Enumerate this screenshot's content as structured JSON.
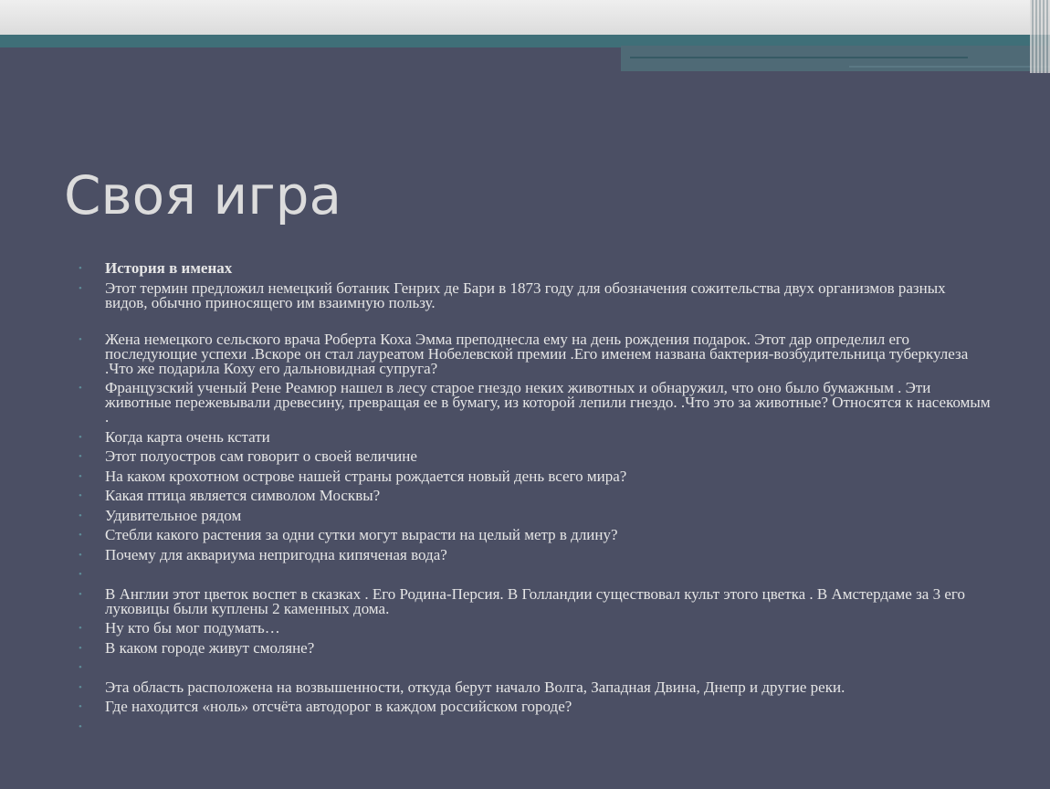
{
  "slide": {
    "title": "Своя игра",
    "bullet_glyph": "•",
    "items": [
      {
        "text": "История в именах",
        "bold": true
      },
      {
        "text": "Этот термин предложил немецкий ботаник  Генрих де Бари в 1873 году для обозначения сожительства двух организмов разных видов, обычно приносящего им взаимную пользу."
      },
      {
        "text": "Жена немецкого сельского врача Роберта Коха Эмма преподнесла ему на день рождения подарок. Этот дар определил его последующие успехи .Вскоре он стал лауреатом Нобелевской премии .Его именем названа бактерия-возбудительница туберкулеза .Что же подарила Коху его дальновидная супруга?"
      },
      {
        "text": "Французский ученый Рене Реамюр нашел в лесу старое гнездо неких животных и обнаружил, что оно было бумажным . Эти животные пережевывали древесину, превращая ее  в бумагу, из которой лепили гнездо. .Что это за животные? Относятся к насекомым ."
      },
      {
        "text": "Когда карта очень кстати"
      },
      {
        "text": "Этот полуостров сам говорит о своей величине"
      },
      {
        "text": "На каком крохотном острове нашей страны рождается новый день всего мира?"
      },
      {
        "text": "Какая птица является символом Москвы?"
      },
      {
        "text": "Удивительное рядом"
      },
      {
        "text": "Стебли какого растения за одни сутки могут вырасти на целый метр в длину?"
      },
      {
        "text": "Почему для аквариума непригодна кипяченая вода?"
      },
      {
        "text": ""
      },
      {
        "text": "В Англии этот цветок воспет в сказках . Его Родина-Персия. В Голландии существовал культ этого цветка . В Амстердаме за 3 его луковицы были куплены 2 каменных дома."
      },
      {
        "text": "Ну кто бы мог подумать…"
      },
      {
        "text": "В каком городе живут  смоляне?"
      },
      {
        "text": ""
      },
      {
        "text": "Эта область расположена на  возвышенности, откуда берут начало Волга, Западная Двина, Днепр и другие реки."
      },
      {
        "text": "Где находится «ноль» отсчёта автодорог в каждом российском городе?"
      },
      {
        "text": ""
      }
    ]
  },
  "colors": {
    "background": "#4b4f64",
    "title": "#dcdcdc",
    "text": "#e6e6e6",
    "bullet": "#5e8d98",
    "accent_band": "#3f6f78"
  }
}
